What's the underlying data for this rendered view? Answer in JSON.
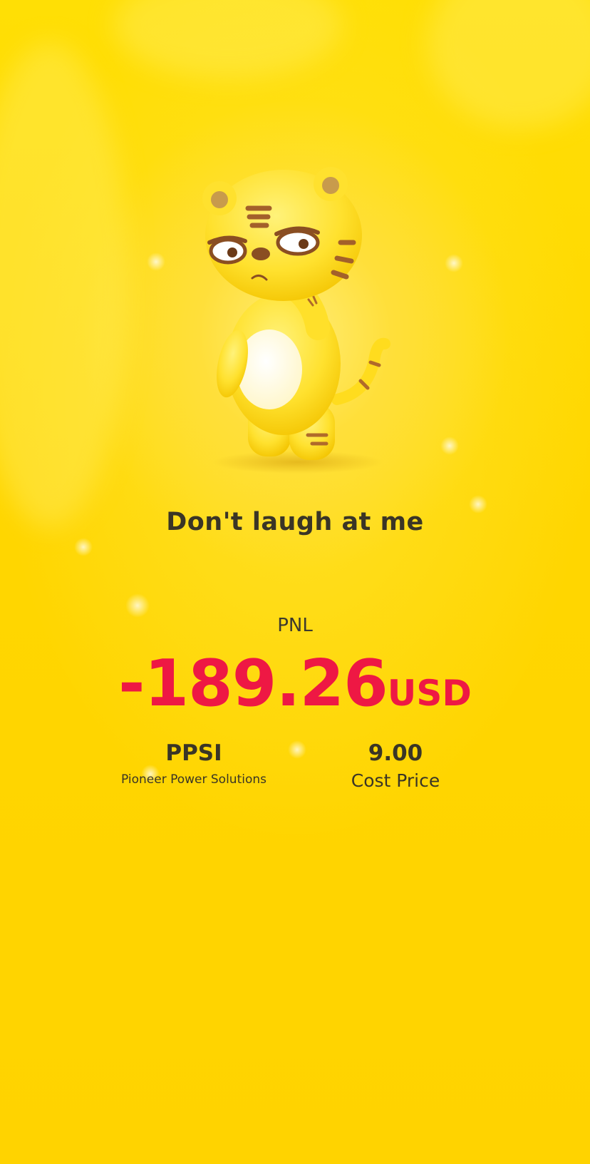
{
  "headline": "Don't laugh at me",
  "pnl": {
    "label": "PNL",
    "value": "-189.26",
    "currency": "USD"
  },
  "stock": {
    "ticker": "PPSI",
    "name": "Pioneer Power Solutions"
  },
  "cost": {
    "value": "9.00",
    "label": "Cost Price"
  },
  "colors": {
    "background": "#ffd600",
    "loss": "#ee1844",
    "text": "#3a3526"
  },
  "icons": {
    "mascot": "tiger-mascot-illustration"
  }
}
